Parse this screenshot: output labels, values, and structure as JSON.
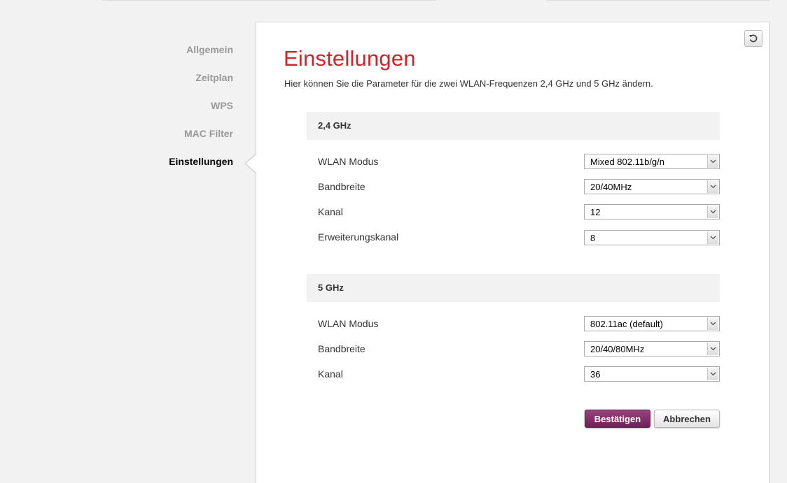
{
  "sidebar": {
    "items": [
      {
        "label": "Allgemein"
      },
      {
        "label": "Zeitplan"
      },
      {
        "label": "WPS"
      },
      {
        "label": "MAC Filter"
      },
      {
        "label": "Einstellungen",
        "active": true
      }
    ]
  },
  "main": {
    "title": "Einstellungen",
    "description": "Hier können Sie die Parameter für die zwei WLAN-Frequenzen 2,4 GHz und 5 GHz ändern.",
    "sections": [
      {
        "header": "2,4 GHz",
        "rows": [
          {
            "label": "WLAN Modus",
            "value": "Mixed 802.11b/g/n"
          },
          {
            "label": "Bandbreite",
            "value": "20/40MHz"
          },
          {
            "label": "Kanal",
            "value": "12"
          },
          {
            "label": "Erweiterungskanal",
            "value": "8"
          }
        ]
      },
      {
        "header": "5 GHz",
        "rows": [
          {
            "label": "WLAN Modus",
            "value": "802.11ac (default)"
          },
          {
            "label": "Bandbreite",
            "value": "20/40/80MHz"
          },
          {
            "label": "Kanal",
            "value": "36"
          }
        ]
      }
    ],
    "buttons": {
      "confirm_label": "Bestätigen",
      "cancel_label": "Abbrechen"
    }
  },
  "icons": {
    "reset": "refresh-icon",
    "dropdown": "chevron-down-icon"
  },
  "colors": {
    "title": "#d2232a",
    "confirm_button": "#7d2a66"
  }
}
